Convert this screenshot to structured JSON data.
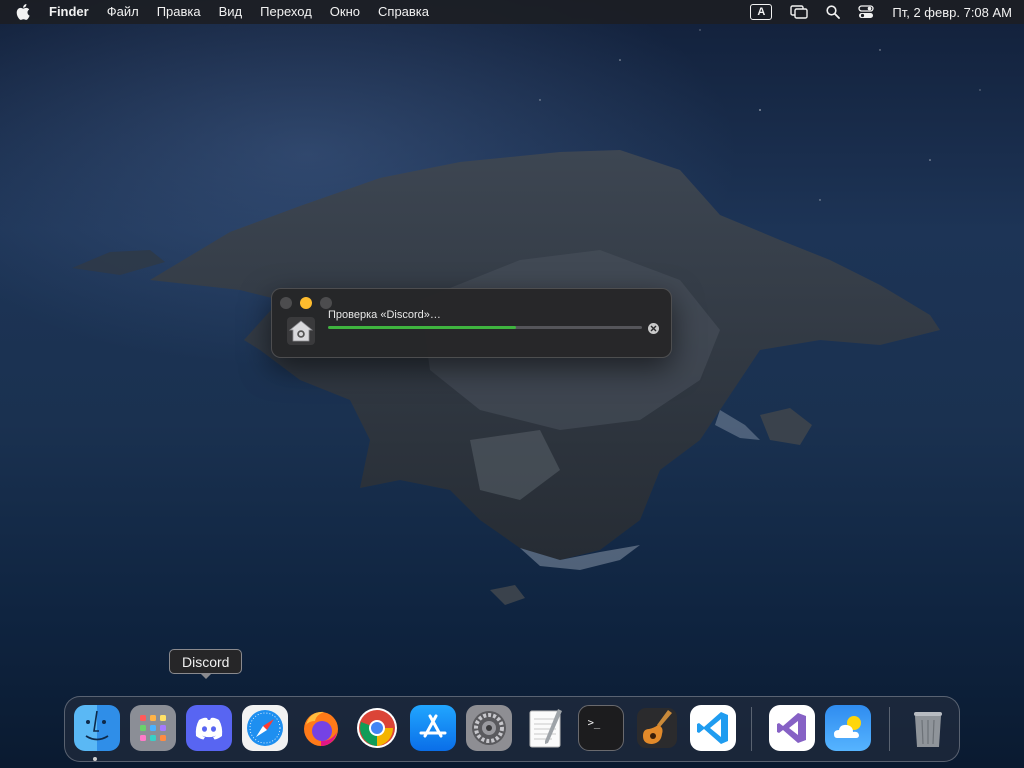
{
  "menubar": {
    "apple_icon": "apple-icon",
    "app_name": "Finder",
    "menus": [
      "Файл",
      "Правка",
      "Вид",
      "Переход",
      "Окно",
      "Справка"
    ],
    "keyboard_layout": "A",
    "datetime": "Пт, 2 февр.  7:08 AM"
  },
  "dialog": {
    "title": "Проверка «Discord»…",
    "progress": 0.6,
    "progress_color": "#3fb43f"
  },
  "tooltip": {
    "text": "Discord"
  },
  "dock": {
    "items": [
      "Finder",
      "Launchpad",
      "Discord",
      "Safari",
      "Firefox",
      "Google Chrome",
      "App Store",
      "System Preferences",
      "TextEdit",
      "Terminal",
      "GarageBand",
      "Visual Studio Code",
      "Visual Studio",
      "Weather",
      "Trash"
    ]
  }
}
